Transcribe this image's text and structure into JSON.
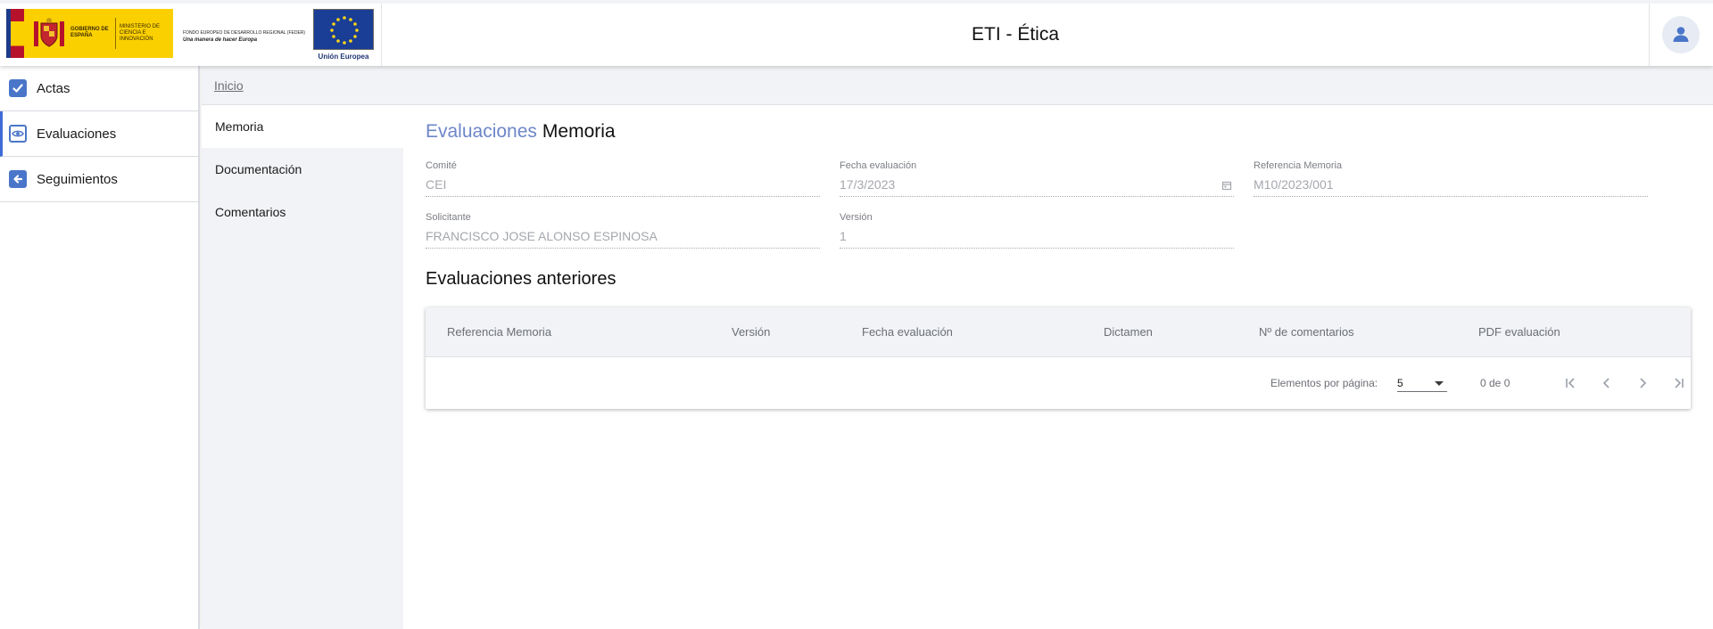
{
  "header": {
    "title": "ETI - Ética",
    "gov_logo_text1": "GOBIERNO DE ESPAÑA",
    "gov_logo_text2": "MINISTERIO DE CIENCIA E INNOVACIÓN",
    "feder_text": "FONDO EUROPEO DE DESARROLLO REGIONAL (FEDER)",
    "feder_slogan": "Una manera de hacer Europa",
    "eu_caption": "Unión Europea",
    "user_icon": "user-icon"
  },
  "sidebar": {
    "items": [
      {
        "label": "Actas",
        "icon": "checklist-icon"
      },
      {
        "label": "Evaluaciones",
        "icon": "eye-icon"
      },
      {
        "label": "Seguimientos",
        "icon": "arrow-left-icon"
      }
    ]
  },
  "breadcrumb": {
    "home": "Inicio"
  },
  "subnav": {
    "items": [
      {
        "label": "Memoria"
      },
      {
        "label": "Documentación"
      },
      {
        "label": "Comentarios"
      }
    ]
  },
  "main": {
    "heading_accent": "Evaluaciones",
    "heading_rest": "Memoria",
    "fields": {
      "comite": {
        "label": "Comité",
        "value": "CEI"
      },
      "fecha_evaluacion": {
        "label": "Fecha evaluación",
        "value": "17/3/2023"
      },
      "referencia_memoria": {
        "label": "Referencia Memoria",
        "value": "M10/2023/001"
      },
      "solicitante": {
        "label": "Solicitante",
        "value": "FRANCISCO JOSE ALONSO ESPINOSA"
      },
      "version": {
        "label": "Versión",
        "value": "1"
      }
    },
    "section_title": "Evaluaciones anteriores",
    "table": {
      "columns": [
        "Referencia Memoria",
        "Versión",
        "Fecha evaluación",
        "Dictamen",
        "Nº de comentarios",
        "PDF evaluación"
      ],
      "rows": []
    },
    "paginator": {
      "items_per_page_label": "Elementos por página:",
      "page_size": "5",
      "range": "0 de 0"
    }
  },
  "colors": {
    "accent": "#6d86c8",
    "icon_blue": "#4a76c9",
    "panel_bg": "#f1f3f6",
    "gov_yellow": "#fbd000",
    "eu_blue": "#1a3e95"
  }
}
